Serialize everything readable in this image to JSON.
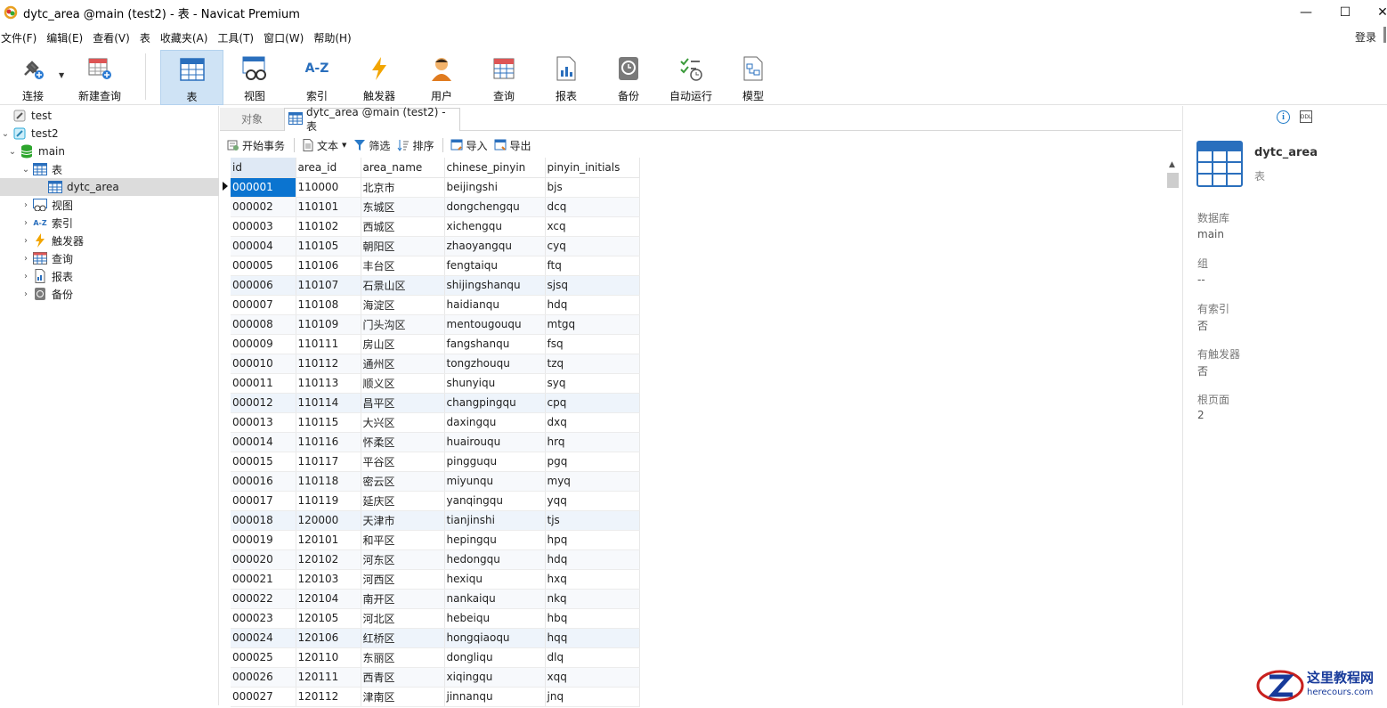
{
  "window": {
    "title": "dytc_area @main (test2) - 表 - Navicat Premium",
    "minimize": "—",
    "maximize": "☐",
    "close": "✕"
  },
  "menu": [
    "文件(F)",
    "编辑(E)",
    "查看(V)",
    "表",
    "收藏夹(A)",
    "工具(T)",
    "窗口(W)",
    "帮助(H)"
  ],
  "login": "登录",
  "toolbar": {
    "connect": "连接",
    "new_query": "新建查询",
    "table": "表",
    "view": "视图",
    "index": "索引",
    "trigger": "触发器",
    "user": "用户",
    "query": "查询",
    "report": "报表",
    "backup": "备份",
    "automation": "自动运行",
    "model": "模型",
    "index_icon_text": "A-Z"
  },
  "tree": {
    "conn1": "test",
    "conn2": "test2",
    "db": "main",
    "tables": "表",
    "table_item": "dytc_area",
    "views": "视图",
    "indexes": "索引",
    "triggers": "触发器",
    "queries": "查询",
    "reports": "报表",
    "backups": "备份"
  },
  "tabs": {
    "objects": "对象",
    "table_tab": "dytc_area @main (test2) - 表"
  },
  "subbar": {
    "begin_tx": "开始事务",
    "text": "文本",
    "filter": "筛选",
    "sort": "排序",
    "import": "导入",
    "export": "导出"
  },
  "grid": {
    "columns": [
      "id",
      "area_id",
      "area_name",
      "chinese_pinyin",
      "pinyin_initials"
    ],
    "rows": [
      [
        "000001",
        "110000",
        "北京市",
        "beijingshi",
        "bjs"
      ],
      [
        "000002",
        "110101",
        "东城区",
        "dongchengqu",
        "dcq"
      ],
      [
        "000003",
        "110102",
        "西城区",
        "xichengqu",
        "xcq"
      ],
      [
        "000004",
        "110105",
        "朝阳区",
        "zhaoyangqu",
        "cyq"
      ],
      [
        "000005",
        "110106",
        "丰台区",
        "fengtaiqu",
        "ftq"
      ],
      [
        "000006",
        "110107",
        "石景山区",
        "shijingshanqu",
        "sjsq"
      ],
      [
        "000007",
        "110108",
        "海淀区",
        "haidianqu",
        "hdq"
      ],
      [
        "000008",
        "110109",
        "门头沟区",
        "mentougouqu",
        "mtgq"
      ],
      [
        "000009",
        "110111",
        "房山区",
        "fangshanqu",
        "fsq"
      ],
      [
        "000010",
        "110112",
        "通州区",
        "tongzhouqu",
        "tzq"
      ],
      [
        "000011",
        "110113",
        "顺义区",
        "shunyiqu",
        "syq"
      ],
      [
        "000012",
        "110114",
        "昌平区",
        "changpingqu",
        "cpq"
      ],
      [
        "000013",
        "110115",
        "大兴区",
        "daxingqu",
        "dxq"
      ],
      [
        "000014",
        "110116",
        "怀柔区",
        "huairouqu",
        "hrq"
      ],
      [
        "000015",
        "110117",
        "平谷区",
        "pingguqu",
        "pgq"
      ],
      [
        "000016",
        "110118",
        "密云区",
        "miyunqu",
        "myq"
      ],
      [
        "000017",
        "110119",
        "延庆区",
        "yanqingqu",
        "yqq"
      ],
      [
        "000018",
        "120000",
        "天津市",
        "tianjinshi",
        "tjs"
      ],
      [
        "000019",
        "120101",
        "和平区",
        "hepingqu",
        "hpq"
      ],
      [
        "000020",
        "120102",
        "河东区",
        "hedongqu",
        "hdq"
      ],
      [
        "000021",
        "120103",
        "河西区",
        "hexiqu",
        "hxq"
      ],
      [
        "000022",
        "120104",
        "南开区",
        "nankaiqu",
        "nkq"
      ],
      [
        "000023",
        "120105",
        "河北区",
        "hebeiqu",
        "hbq"
      ],
      [
        "000024",
        "120106",
        "红桥区",
        "hongqiaoqu",
        "hqq"
      ],
      [
        "000025",
        "120110",
        "东丽区",
        "dongliqu",
        "dlq"
      ],
      [
        "000026",
        "120111",
        "西青区",
        "xiqingqu",
        "xqq"
      ],
      [
        "000027",
        "120112",
        "津南区",
        "jinnanqu",
        "jnq"
      ]
    ]
  },
  "info_panel": {
    "name": "dytc_area",
    "type": "表",
    "db_label": "数据库",
    "db_value": "main",
    "group_label": "组",
    "group_value": "--",
    "has_index_label": "有索引",
    "has_index_value": "否",
    "has_trigger_label": "有触发器",
    "has_trigger_value": "否",
    "root_page_label": "根页面",
    "root_page_value": "2",
    "info_icon_text": "i",
    "ddl_icon_text": "DDL"
  },
  "watermark": {
    "line1": "这里教程网",
    "line2": "herecours.com"
  },
  "colors": {
    "selection": "#0b74d0",
    "toolbar_active": "#cfe3f5",
    "accent_blue": "#1b78c6"
  }
}
